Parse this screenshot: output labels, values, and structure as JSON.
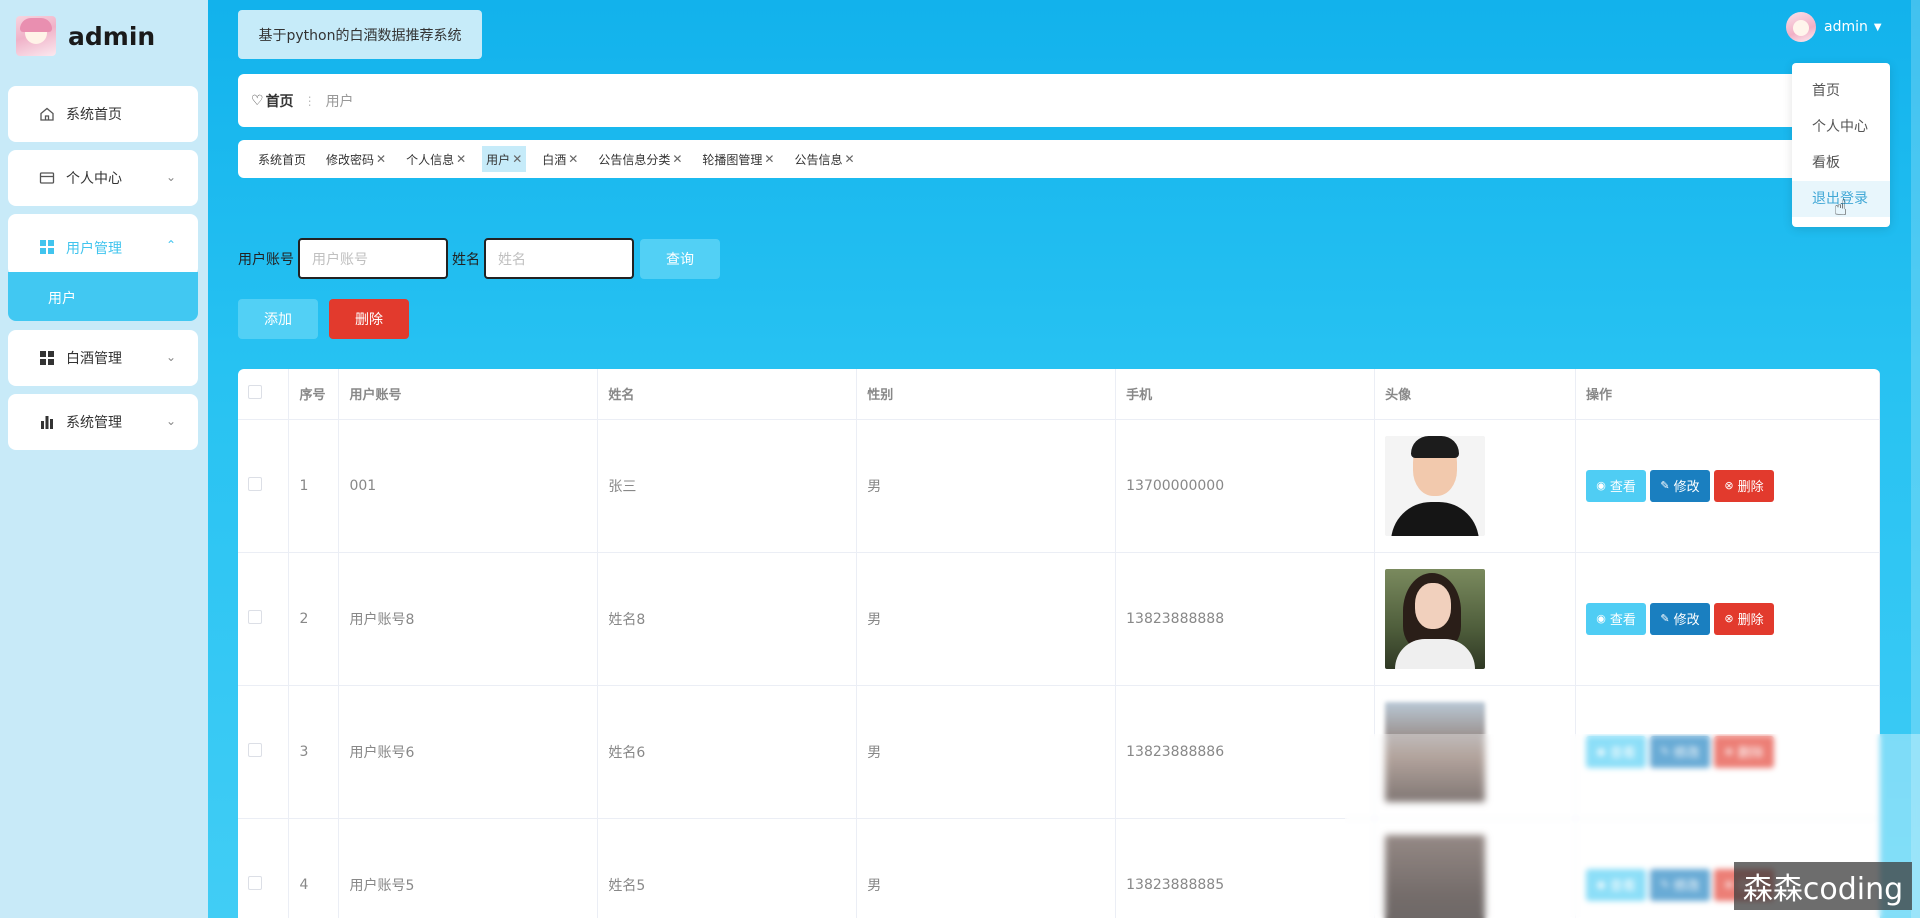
{
  "sidebar": {
    "brand": "admin",
    "items": [
      {
        "label": "系统首页",
        "icon": "home-icon"
      },
      {
        "label": "个人中心",
        "icon": "card-icon"
      },
      {
        "label": "用户管理",
        "icon": "grid-icon"
      },
      {
        "label": "白酒管理",
        "icon": "grid-icon"
      },
      {
        "label": "系统管理",
        "icon": "bar-chart-icon"
      }
    ],
    "submenu": {
      "label": "用户"
    }
  },
  "header": {
    "system_title": "基于python的白酒数据推荐系统",
    "user": "admin"
  },
  "breadcrumb": {
    "home": "首页",
    "current": "用户"
  },
  "tags": [
    {
      "label": "系统首页",
      "closable": false
    },
    {
      "label": "修改密码",
      "closable": true
    },
    {
      "label": "个人信息",
      "closable": true
    },
    {
      "label": "用户",
      "closable": true,
      "active": true
    },
    {
      "label": "白酒",
      "closable": true
    },
    {
      "label": "公告信息分类",
      "closable": true
    },
    {
      "label": "轮播图管理",
      "closable": true
    },
    {
      "label": "公告信息",
      "closable": true
    }
  ],
  "search": {
    "account_label": "用户账号",
    "account_placeholder": "用户账号",
    "name_label": "姓名",
    "name_placeholder": "姓名",
    "query_button": "查询"
  },
  "actions": {
    "add": "添加",
    "delete": "删除"
  },
  "table": {
    "headers": [
      "序号",
      "用户账号",
      "姓名",
      "性别",
      "手机",
      "头像",
      "操作"
    ],
    "rows": [
      {
        "index": "1",
        "account": "001",
        "name": "张三",
        "gender": "男",
        "phone": "13700000000"
      },
      {
        "index": "2",
        "account": "用户账号8",
        "name": "姓名8",
        "gender": "男",
        "phone": "13823888888"
      },
      {
        "index": "3",
        "account": "用户账号6",
        "name": "姓名6",
        "gender": "男",
        "phone": "13823888886"
      },
      {
        "index": "4",
        "account": "用户账号5",
        "name": "姓名5",
        "gender": "男",
        "phone": "13823888885"
      }
    ],
    "ops": {
      "view": "查看",
      "edit": "修改",
      "delete": "删除"
    }
  },
  "dropdown": {
    "items": [
      "首页",
      "个人中心",
      "看板",
      "退出登录"
    ]
  },
  "watermark": "森森coding",
  "colors": {
    "accent": "#41c4ee",
    "danger": "#e23a2d",
    "edit": "#1a7fc0",
    "sidebar_bg": "#c8eaf8"
  }
}
